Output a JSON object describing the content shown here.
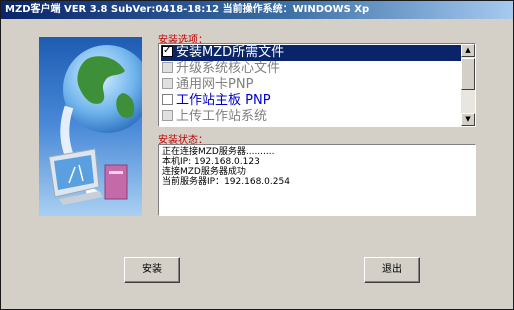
{
  "window": {
    "title": "MZD客户端 VER 3.8  SubVer:0418-18:12  当前操作系统：WINDOWS Xp"
  },
  "install_options": {
    "label": "安装选项：",
    "items": [
      {
        "label": "安装MZD所需文件",
        "state": "checked-selected"
      },
      {
        "label": "升级系统核心文件",
        "state": "disabled"
      },
      {
        "label": "通用网卡PNP",
        "state": "disabled"
      },
      {
        "label": "工作站主板 PNP",
        "state": "enabled"
      },
      {
        "label": "上传工作站系统",
        "state": "disabled"
      }
    ]
  },
  "install_status": {
    "label": "安装状态：",
    "lines": [
      "正在连接MZD服务器..........",
      "本机IP: 192.168.0.123",
      "连接MZD服务器成功",
      "当前服务器IP：192.168.0.254"
    ]
  },
  "buttons": {
    "install": "安装",
    "exit": "退出"
  },
  "colors": {
    "title_gradient_start": "#0a246a",
    "section_label": "#c00000",
    "enabled_option": "#0000cc",
    "disabled_option": "#808080",
    "selection": "#0a246a"
  }
}
